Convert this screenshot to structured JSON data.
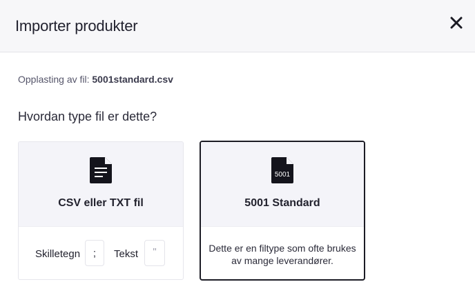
{
  "dialog": {
    "title": "Importer produkter",
    "close_icon": "close-icon"
  },
  "upload": {
    "prefix": "Opplasting av fil:",
    "filename": "5001standard.csv"
  },
  "question": "Hvordan type fil er dette?",
  "options": [
    {
      "icon": "document-icon",
      "label": "CSV eller TXT fil",
      "separator_label": "Skilletegn",
      "separator_value": ";",
      "text_label": "Tekst",
      "text_value": "\"",
      "selected": false
    },
    {
      "icon": "file-5001-icon",
      "icon_text": "5001",
      "label": "5001 Standard",
      "description": "Dette er en filtype som ofte brukes av mange leverandører.",
      "selected": true
    }
  ]
}
